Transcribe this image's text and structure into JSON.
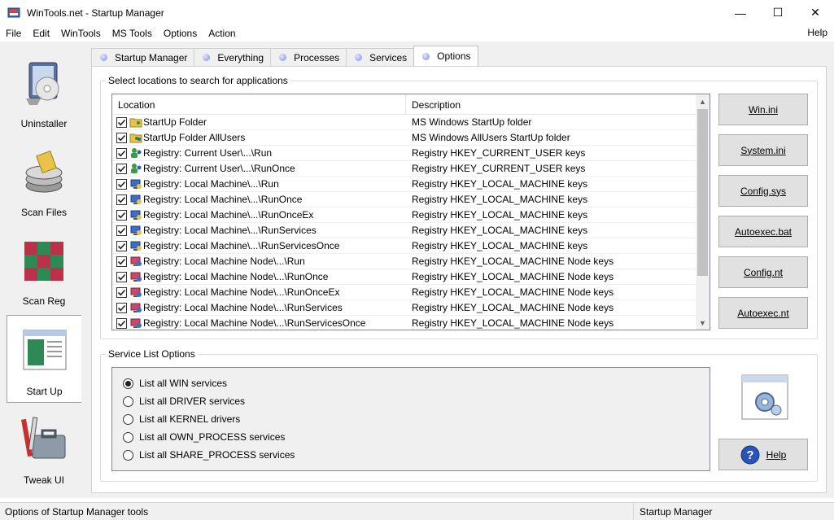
{
  "window": {
    "title": "WinTools.net - Startup Manager",
    "minimize": "—",
    "maximize": "☐",
    "close": "✕"
  },
  "menu": {
    "items": [
      "File",
      "Edit",
      "WinTools",
      "MS Tools",
      "Options",
      "Action"
    ],
    "help": "Help"
  },
  "sidebar": {
    "items": [
      {
        "label": "Uninstaller",
        "icon": "uninstaller-icon"
      },
      {
        "label": "Scan Files",
        "icon": "scan-files-icon"
      },
      {
        "label": "Scan Reg",
        "icon": "scan-reg-icon"
      },
      {
        "label": "Start Up",
        "icon": "startup-icon",
        "active": true
      },
      {
        "label": "Tweak UI",
        "icon": "tweak-ui-icon"
      }
    ]
  },
  "tabs": [
    {
      "label": "Startup Manager"
    },
    {
      "label": "Everything"
    },
    {
      "label": "Processes"
    },
    {
      "label": "Services"
    },
    {
      "label": "Options",
      "active": true
    }
  ],
  "locations_group": {
    "title": "Select locations to search for applications",
    "columns": [
      "Location",
      "Description"
    ],
    "rows": [
      {
        "location": "StartUp Folder",
        "description": "MS Windows StartUp folder",
        "icon": "folder-user-icon",
        "checked": true
      },
      {
        "location": "StartUp Folder AllUsers",
        "description": "MS Windows AllUsers StartUp folder",
        "icon": "folder-users-icon",
        "checked": true
      },
      {
        "location": "Registry: Current User\\...\\Run",
        "description": "Registry HKEY_CURRENT_USER keys",
        "icon": "registry-user-icon",
        "checked": true
      },
      {
        "location": "Registry: Current User\\...\\RunOnce",
        "description": "Registry HKEY_CURRENT_USER keys",
        "icon": "registry-user-icon",
        "checked": true
      },
      {
        "location": "Registry: Local Machine\\...\\Run",
        "description": "Registry HKEY_LOCAL_MACHINE keys",
        "icon": "registry-machine-icon",
        "checked": true
      },
      {
        "location": "Registry: Local Machine\\...\\RunOnce",
        "description": "Registry HKEY_LOCAL_MACHINE keys",
        "icon": "registry-machine-icon",
        "checked": true
      },
      {
        "location": "Registry: Local Machine\\...\\RunOnceEx",
        "description": "Registry HKEY_LOCAL_MACHINE keys",
        "icon": "registry-machine-icon",
        "checked": true
      },
      {
        "location": "Registry: Local Machine\\...\\RunServices",
        "description": "Registry HKEY_LOCAL_MACHINE keys",
        "icon": "registry-machine-icon",
        "checked": true
      },
      {
        "location": "Registry: Local Machine\\...\\RunServicesOnce",
        "description": "Registry HKEY_LOCAL_MACHINE keys",
        "icon": "registry-machine-icon",
        "checked": true
      },
      {
        "location": "Registry: Local Machine Node\\...\\Run",
        "description": "Registry HKEY_LOCAL_MACHINE Node keys",
        "icon": "registry-node-icon",
        "checked": true
      },
      {
        "location": "Registry: Local Machine Node\\...\\RunOnce",
        "description": "Registry HKEY_LOCAL_MACHINE Node keys",
        "icon": "registry-node-icon",
        "checked": true
      },
      {
        "location": "Registry: Local Machine Node\\...\\RunOnceEx",
        "description": "Registry HKEY_LOCAL_MACHINE Node keys",
        "icon": "registry-node-icon",
        "checked": true
      },
      {
        "location": "Registry: Local Machine Node\\...\\RunServices",
        "description": "Registry HKEY_LOCAL_MACHINE Node keys",
        "icon": "registry-node-icon",
        "checked": true
      },
      {
        "location": "Registry: Local Machine Node\\...\\RunServicesOnce",
        "description": "Registry HKEY_LOCAL_MACHINE Node keys",
        "icon": "registry-node-icon",
        "checked": true
      }
    ]
  },
  "file_buttons": [
    "Win.ini",
    "System.ini",
    "Config.sys",
    "Autoexec.bat",
    "Config.nt",
    "Autoexec.nt"
  ],
  "service_group": {
    "title": "Service List Options",
    "options": [
      {
        "label": "List all WIN services",
        "selected": true
      },
      {
        "label": "List all DRIVER services",
        "selected": false
      },
      {
        "label": "List all KERNEL drivers",
        "selected": false
      },
      {
        "label": "List all OWN_PROCESS services",
        "selected": false
      },
      {
        "label": "List all SHARE_PROCESS services",
        "selected": false
      }
    ],
    "help_button": "Help"
  },
  "statusbar": {
    "left": "Options of Startup Manager tools",
    "right": "Startup Manager"
  }
}
